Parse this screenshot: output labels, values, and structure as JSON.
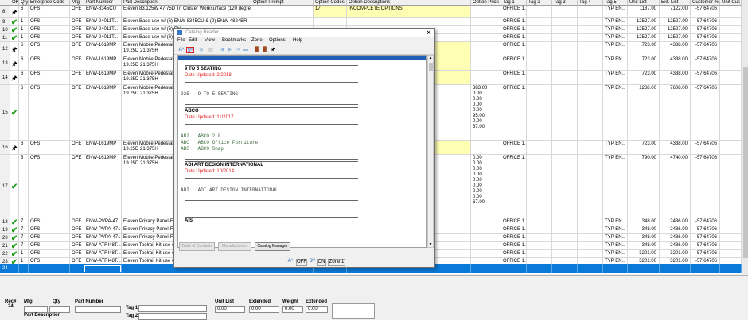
{
  "columns": [
    "OK",
    "Qty",
    "Enterprise Code",
    "Mfg",
    "Part Number",
    "Part Description",
    "Option Prompt",
    "Option Codes",
    "Option Descriptions",
    "Option Price",
    "Tag 1",
    "Tag 2",
    "Tag 3",
    "Tag 4",
    "Tag 5",
    "Unit List",
    "Ext. List",
    "Customer %",
    "Unit Cus"
  ],
  "rows": [
    {
      "num": "8",
      "ok": "pin",
      "qty": "6",
      "ent": "OFS",
      "mfg": "OFE",
      "part": "ENW-8345CU",
      "desc": "Eleven 83.125W 47.75D Tri Cluster Worksurface (120 degree)",
      "oc": "17",
      "od": "INCOMPLETE OPTIONS",
      "yellow": true,
      "op": "",
      "tag1": "OFFICE 1...",
      "tag5": "TYP EN...",
      "ul": "1187.00",
      "el": "7122.00",
      "cp": "-57.64706"
    },
    {
      "num": "9",
      "ok": "check",
      "qty": "1",
      "ent": "OFS",
      "mfg": "OFE",
      "part": "ENW-24011T...",
      "desc": "Eleven Base-use w/ (6) ENW-8345CU & (2) ENW-4824BR",
      "oc": "",
      "od": "",
      "yellow": false,
      "op": "",
      "tag1": "OFFICE 1...",
      "tag5": "TYP EN...",
      "ul": "12527.00",
      "el": "12527.00",
      "cp": "-57.64706"
    },
    {
      "num": "10",
      "ok": "check",
      "qty": "1",
      "ent": "OFS",
      "mfg": "OFE",
      "part": "ENW-24011T...",
      "desc": "Eleven Base-use w/ (6) EN",
      "oc": "",
      "od": "",
      "yellow": false,
      "op": "",
      "tag1": "OFFICE 1...",
      "tag5": "TYP EN...",
      "ul": "12527.00",
      "el": "12527.00",
      "cp": "-57.64706"
    },
    {
      "num": "11",
      "ok": "check",
      "qty": "1",
      "ent": "OFS",
      "mfg": "OFE",
      "part": "ENW-24011T...",
      "desc": "Eleven Base-use w/ (6) EN",
      "oc": "",
      "od": "",
      "yellow": false,
      "op": "",
      "tag1": "OFFICE 1...",
      "tag5": "TYP EN...",
      "ul": "12527.00",
      "el": "12527.00",
      "cp": "-57.64706"
    },
    {
      "num": "12",
      "ok": "pin",
      "qty": "6",
      "ent": "OFS",
      "mfg": "OFE",
      "part": "ENW-1619MP",
      "desc": "Eleven Mobile Pedestal, B\n19.25D 21.375H",
      "oc": "",
      "od": "",
      "yellow": true,
      "op": "",
      "tag1": "OFFICE 1...",
      "tag5": "TYP EN...",
      "ul": "723.00",
      "el": "4338.00",
      "cp": "-57.64706"
    },
    {
      "num": "13",
      "ok": "pin",
      "qty": "6",
      "ent": "OFS",
      "mfg": "OFE",
      "part": "ENW-1619MP",
      "desc": "Eleven Mobile Pedestal, B\n19.25D 21.375H",
      "oc": "",
      "od": "",
      "yellow": true,
      "op": "",
      "tag1": "OFFICE 1...",
      "tag5": "TYP EN...",
      "ul": "723.00",
      "el": "4338.00",
      "cp": "-57.64706"
    },
    {
      "num": "14",
      "ok": "pin",
      "qty": "6",
      "ent": "OFS",
      "mfg": "OFE",
      "part": "ENW-1619MP",
      "desc": "Eleven Mobile Pedestal, B\n19.25D 21.375H",
      "oc": "",
      "od": "",
      "yellow": true,
      "op": "",
      "tag1": "OFFICE 1...",
      "tag5": "TYP EN...",
      "ul": "723.00",
      "el": "4338.00",
      "cp": "-57.64706"
    },
    {
      "num": "15",
      "ok": "check",
      "qty": "6",
      "ent": "OFS",
      "mfg": "OFE",
      "part": "ENW-1619MP",
      "desc": "Eleven Mobile Pedestal, B\n19.25D 21.375H",
      "oc": "",
      "od": "",
      "yellow": false,
      "op": "383.00\n0.00\n0.00\n0.00\n0.00\n95.00\n0.00\n67.00",
      "tag1": "OFFICE 1...",
      "tag5": "TYP EN...",
      "ul": "1268.00",
      "el": "7608.00",
      "cp": "-57.64706"
    },
    {
      "num": "16",
      "ok": "pin",
      "qty": "6",
      "ent": "OFS",
      "mfg": "OFE",
      "part": "ENW-1619MP",
      "desc": "Eleven Mobile Pedestal, B\n19.25D 21.375H",
      "oc": "",
      "od": "",
      "yellow": true,
      "op": "",
      "tag1": "OFFICE 1...",
      "tag5": "TYP EN...",
      "ul": "723.00",
      "el": "4338.00",
      "cp": "-57.64706"
    },
    {
      "num": "17",
      "ok": "check",
      "qty": "6",
      "ent": "OFS",
      "mfg": "OFE",
      "part": "ENW-1619MP",
      "desc": "Eleven Mobile Pedestal, B\n19.25D 21.375H",
      "oc": "",
      "od": "",
      "yellow": false,
      "op": "0.00\n0.00\n0.00\n0.00\n0.00\n0.00\n0.00\n0.00\n67.00",
      "tag1": "OFFICE 1...",
      "tag5": "TYP EN...",
      "ul": "790.00",
      "el": "4740.00",
      "cp": "-57.64706"
    },
    {
      "num": "18",
      "ok": "check",
      "qty": "7",
      "ent": "OFS",
      "mfg": "OFE",
      "part": "ENW-PVPA-47...",
      "desc": "Eleven Privacy Panel-Fro",
      "oc": "",
      "od": "",
      "yellow": false,
      "op": "",
      "tag1": "OFFICE 1...",
      "tag5": "TYP EN...",
      "ul": "348.00",
      "el": "2436.00",
      "cp": "-57.64706"
    },
    {
      "num": "19",
      "ok": "check",
      "qty": "7",
      "ent": "OFS",
      "mfg": "OFE",
      "part": "ENW-PVPA-47...",
      "desc": "Eleven Privacy Panel-Fro",
      "oc": "",
      "od": "",
      "yellow": false,
      "op": "",
      "tag1": "OFFICE 1...",
      "tag5": "TYP EN...",
      "ul": "348.00",
      "el": "2436.00",
      "cp": "-57.64706"
    },
    {
      "num": "20",
      "ok": "check",
      "qty": "7",
      "ent": "OFS",
      "mfg": "OFE",
      "part": "ENW-PVPA-47...",
      "desc": "Eleven Privacy Panel-Fro",
      "oc": "",
      "od": "",
      "yellow": false,
      "op": "",
      "tag1": "OFFICE 1...",
      "tag5": "TYP EN...",
      "ul": "348.00",
      "el": "2436.00",
      "cp": "-57.64706"
    },
    {
      "num": "21",
      "ok": "check",
      "qty": "7",
      "ent": "OFS",
      "mfg": "OFE",
      "part": "ENW-ATRI48T...",
      "desc": "Eleven Toolrail Kit-use w",
      "oc": "",
      "od": "",
      "yellow": false,
      "op": "",
      "tag1": "OFFICE 1...",
      "tag5": "TYP EN...",
      "ul": "348.00",
      "el": "2436.00",
      "cp": "-57.64706"
    },
    {
      "num": "22",
      "ok": "check",
      "qty": "1",
      "ent": "OFS",
      "mfg": "OFE",
      "part": "ENW-ATRI48T...",
      "desc": "Eleven Toolrail Kit-use w",
      "oc": "",
      "od": "",
      "yellow": false,
      "op": "",
      "tag1": "OFFICE 1...",
      "tag5": "TYP EN...",
      "ul": "3201.00",
      "el": "3201.00",
      "cp": "-57.64706"
    },
    {
      "num": "23",
      "ok": "check",
      "qty": "1",
      "ent": "OFS",
      "mfg": "OFE",
      "part": "ENW-ATRI48T...",
      "desc": "Eleven Toolrail Kit-use w",
      "oc": "",
      "od": "",
      "yellow": false,
      "op": "",
      "tag1": "OFFICE 1...",
      "tag5": "TYP EN...",
      "ul": "3201.00",
      "el": "3201.00",
      "cp": "-57.64706"
    }
  ],
  "selected_row_num": "24",
  "bottom": {
    "rec_label": "Rec#",
    "rec_value": "24",
    "mfg": "Mfg",
    "qty": "Qty",
    "part_number": "Part Number",
    "part_description": "Part Description",
    "tag1": "Tag 1",
    "tag2": "Tag 2",
    "unit_list": "Unit List",
    "extended1": "Extended",
    "weight": "Weight",
    "extended2": "Extended",
    "unit_list_value": "0.00",
    "extended1_value": "0.00",
    "weight_value": "0.00",
    "extended2_value": "0.00"
  },
  "catalog_reader": {
    "title": "Catalog Reader",
    "menu": [
      "File",
      "Edit",
      "View",
      "Bookmarks",
      "Zone",
      "Options",
      "Help"
    ],
    "sections": [
      {
        "name": "9 TO 5 SEATING",
        "date": "Date Updated: 2/2018",
        "entries": [
          {
            "code": "925",
            "label": "9 TO 5 SEATING",
            "gray": true
          }
        ]
      },
      {
        "name": "ABCO",
        "date": "Date Updated: 11/2017",
        "entries": [
          {
            "code": "AB2",
            "label": "ABCO 2.0",
            "gray": false
          },
          {
            "code": "ABC",
            "label": "ABCO Office Furniture",
            "gray": false
          },
          {
            "code": "ABS",
            "label": "ABCO Snap",
            "gray": false
          }
        ]
      },
      {
        "name": "ADI ART DESIGN INTERNATIONAL",
        "date": "Date Updated: 10/2014",
        "entries": [
          {
            "code": "ADI",
            "label": "ADI ART DESIGN INTERNATIONAL",
            "gray": true
          }
        ]
      },
      {
        "name": "AIS",
        "date": "",
        "entries": []
      }
    ],
    "buttons": {
      "toc": "Table of Contents",
      "manufacturers": "Manufacturers",
      "catalog_manager": "Catalog Manager"
    },
    "status": {
      "off": "OFF",
      "on": "ON",
      "zone": "Zone 1"
    },
    "tb_labels": {
      "abc": "Aᴬ",
      "sm": "Sᴹ",
      "status_a": "Aᴬ",
      "status_s": "Sᴹ"
    }
  },
  "colors": {
    "selected": "#0a7ad8",
    "incomplete": "#ffffb4",
    "check": "#1e9a1e",
    "date_red": "#e02020"
  }
}
